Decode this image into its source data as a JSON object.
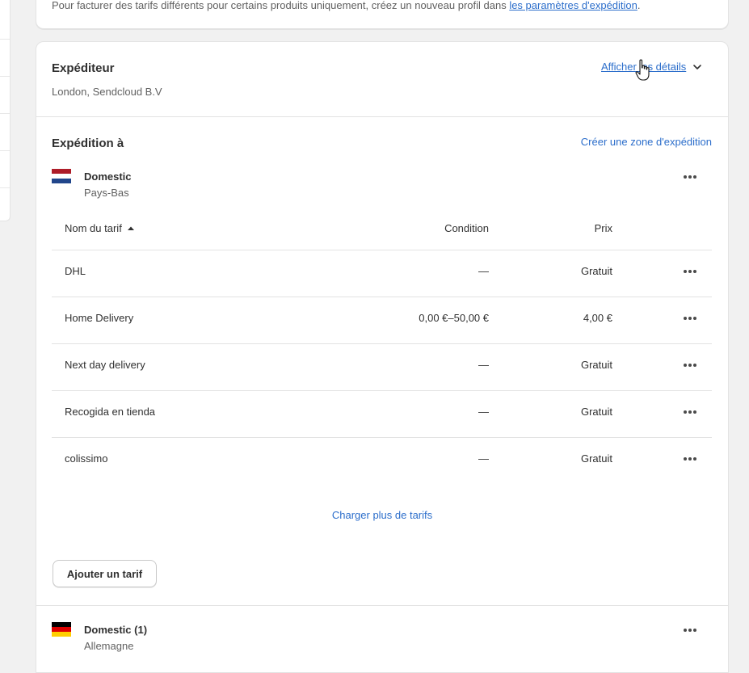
{
  "notice": {
    "text": "Pour facturer des tarifs différents pour certains produits uniquement, créez un nouveau profil dans ",
    "link": "les paramètres d'expédition",
    "end": "."
  },
  "sender": {
    "title": "Expéditeur",
    "address": "London, Sendcloud B.V",
    "details_link": "Afficher les détails"
  },
  "shipping_to": {
    "title": "Expédition à",
    "create_zone_link": "Créer une zone d'expédition"
  },
  "zones": [
    {
      "name": "Domestic",
      "country": "Pays-Bas",
      "flag_colors": [
        "#ae1c28",
        "#ffffff",
        "#21468b"
      ]
    },
    {
      "name": "Domestic (1)",
      "country": "Allemagne",
      "flag_colors": [
        "#000000",
        "#dd0000",
        "#ffce00"
      ]
    }
  ],
  "table": {
    "headers": {
      "name": "Nom du tarif",
      "condition": "Condition",
      "price": "Prix"
    },
    "rows": [
      {
        "name": "DHL",
        "condition": "—",
        "price": "Gratuit"
      },
      {
        "name": "Home Delivery",
        "condition": "0,00 €–50,00 €",
        "price": "4,00 €"
      },
      {
        "name": "Next day delivery",
        "condition": "—",
        "price": "Gratuit"
      },
      {
        "name": "Recogida en tienda",
        "condition": "—",
        "price": "Gratuit"
      },
      {
        "name": "colissimo",
        "condition": "—",
        "price": "Gratuit"
      }
    ]
  },
  "load_more": "Charger plus de tarifs",
  "add_rate_button": "Ajouter un tarif",
  "icons": {
    "more": "more-horizontal-icon",
    "sort": "sort-ascending-icon",
    "chevron": "chevron-down-icon",
    "cursor": "hand-pointer-cursor-icon"
  },
  "colors": {
    "link": "#2c6ecb",
    "text": "#303030",
    "subdued": "#616161"
  }
}
